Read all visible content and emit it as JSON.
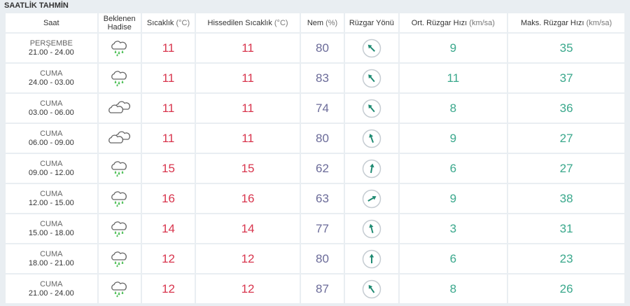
{
  "title": "SAATLİK TAHMİN",
  "headers": {
    "saat": "Saat",
    "hadise_1": "Beklenen",
    "hadise_2": "Hadise",
    "sicaklik": "Sıcaklık",
    "sicaklik_unit": "(°C)",
    "hissedilen": "Hissedilen Sıcaklık",
    "hissedilen_unit": "(°C)",
    "nem": "Nem",
    "nem_unit": "(%)",
    "ruzgar_yonu": "Rüzgar Yönü",
    "ort_ruzgar": "Ort. Rüzgar Hızı",
    "ort_ruzgar_unit": "(km/sa)",
    "maks_ruzgar": "Maks. Rüzgar Hızı",
    "maks_ruzgar_unit": "(km/sa)"
  },
  "colors": {
    "temp": "#d8354d",
    "humidity": "#6b6b99",
    "wind": "#3aa88c",
    "rain": "#4bbf55",
    "cloud": "#666666"
  },
  "rows": [
    {
      "day": "PERŞEMBE",
      "time": "21.00 - 24.00",
      "icon": "rain-cloud-icon",
      "temp": "11",
      "feels": "11",
      "humidity": "80",
      "wind_dir_deg": 315,
      "wind_avg": "9",
      "wind_max": "35"
    },
    {
      "day": "CUMA",
      "time": "24.00 - 03.00",
      "icon": "rain-cloud-icon",
      "temp": "11",
      "feels": "11",
      "humidity": "83",
      "wind_dir_deg": 320,
      "wind_avg": "11",
      "wind_max": "37"
    },
    {
      "day": "CUMA",
      "time": "03.00 - 06.00",
      "icon": "cloudy-icon",
      "temp": "11",
      "feels": "11",
      "humidity": "74",
      "wind_dir_deg": 320,
      "wind_avg": "8",
      "wind_max": "36"
    },
    {
      "day": "CUMA",
      "time": "06.00 - 09.00",
      "icon": "cloudy-icon",
      "temp": "11",
      "feels": "11",
      "humidity": "80",
      "wind_dir_deg": 340,
      "wind_avg": "9",
      "wind_max": "27"
    },
    {
      "day": "CUMA",
      "time": "09.00 - 12.00",
      "icon": "rain-cloud-icon",
      "temp": "15",
      "feels": "15",
      "humidity": "62",
      "wind_dir_deg": 10,
      "wind_avg": "6",
      "wind_max": "27"
    },
    {
      "day": "CUMA",
      "time": "12.00 - 15.00",
      "icon": "rain-cloud-icon",
      "temp": "16",
      "feels": "16",
      "humidity": "63",
      "wind_dir_deg": 60,
      "wind_avg": "9",
      "wind_max": "38"
    },
    {
      "day": "CUMA",
      "time": "15.00 - 18.00",
      "icon": "rain-cloud-icon",
      "temp": "14",
      "feels": "14",
      "humidity": "77",
      "wind_dir_deg": 345,
      "wind_avg": "3",
      "wind_max": "31"
    },
    {
      "day": "CUMA",
      "time": "18.00 - 21.00",
      "icon": "rain-cloud-icon",
      "temp": "12",
      "feels": "12",
      "humidity": "80",
      "wind_dir_deg": 0,
      "wind_avg": "6",
      "wind_max": "23"
    },
    {
      "day": "CUMA",
      "time": "21.00 - 24.00",
      "icon": "rain-cloud-icon",
      "temp": "12",
      "feels": "12",
      "humidity": "87",
      "wind_dir_deg": 325,
      "wind_avg": "8",
      "wind_max": "26"
    }
  ]
}
